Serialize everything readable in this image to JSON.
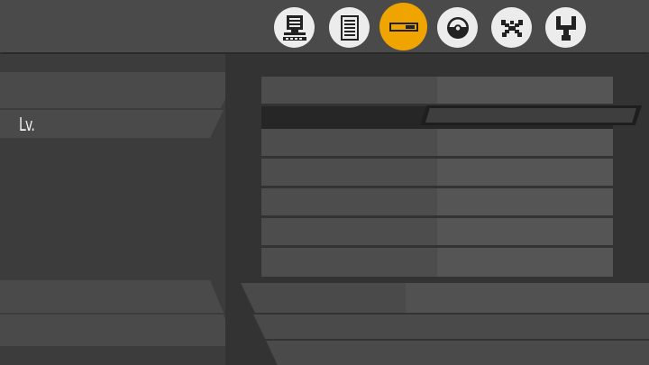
{
  "header": {
    "tabs": [
      {
        "icon": "computer-terminal-icon",
        "active": false
      },
      {
        "icon": "document-list-icon",
        "active": false
      },
      {
        "icon": "item-bar-icon",
        "active": true
      },
      {
        "icon": "pokeball-icon",
        "active": false
      },
      {
        "icon": "crossed-arrows-icon",
        "active": false
      },
      {
        "icon": "branch-fork-icon",
        "active": false
      }
    ],
    "accent_color": "#f0a400"
  },
  "left_panel": {
    "level_label": "Lv.",
    "level_value": ""
  },
  "stats_table": {
    "rows": [
      {
        "label": "",
        "value": "",
        "selected": false
      },
      {
        "label": "",
        "value": "",
        "selected": true
      },
      {
        "label": "",
        "value": "",
        "selected": false
      },
      {
        "label": "",
        "value": "",
        "selected": false
      },
      {
        "label": "",
        "value": "",
        "selected": false
      },
      {
        "label": "",
        "value": "",
        "selected": false
      },
      {
        "label": "",
        "value": "",
        "selected": false
      }
    ],
    "selected_bar_level": 1.0
  }
}
